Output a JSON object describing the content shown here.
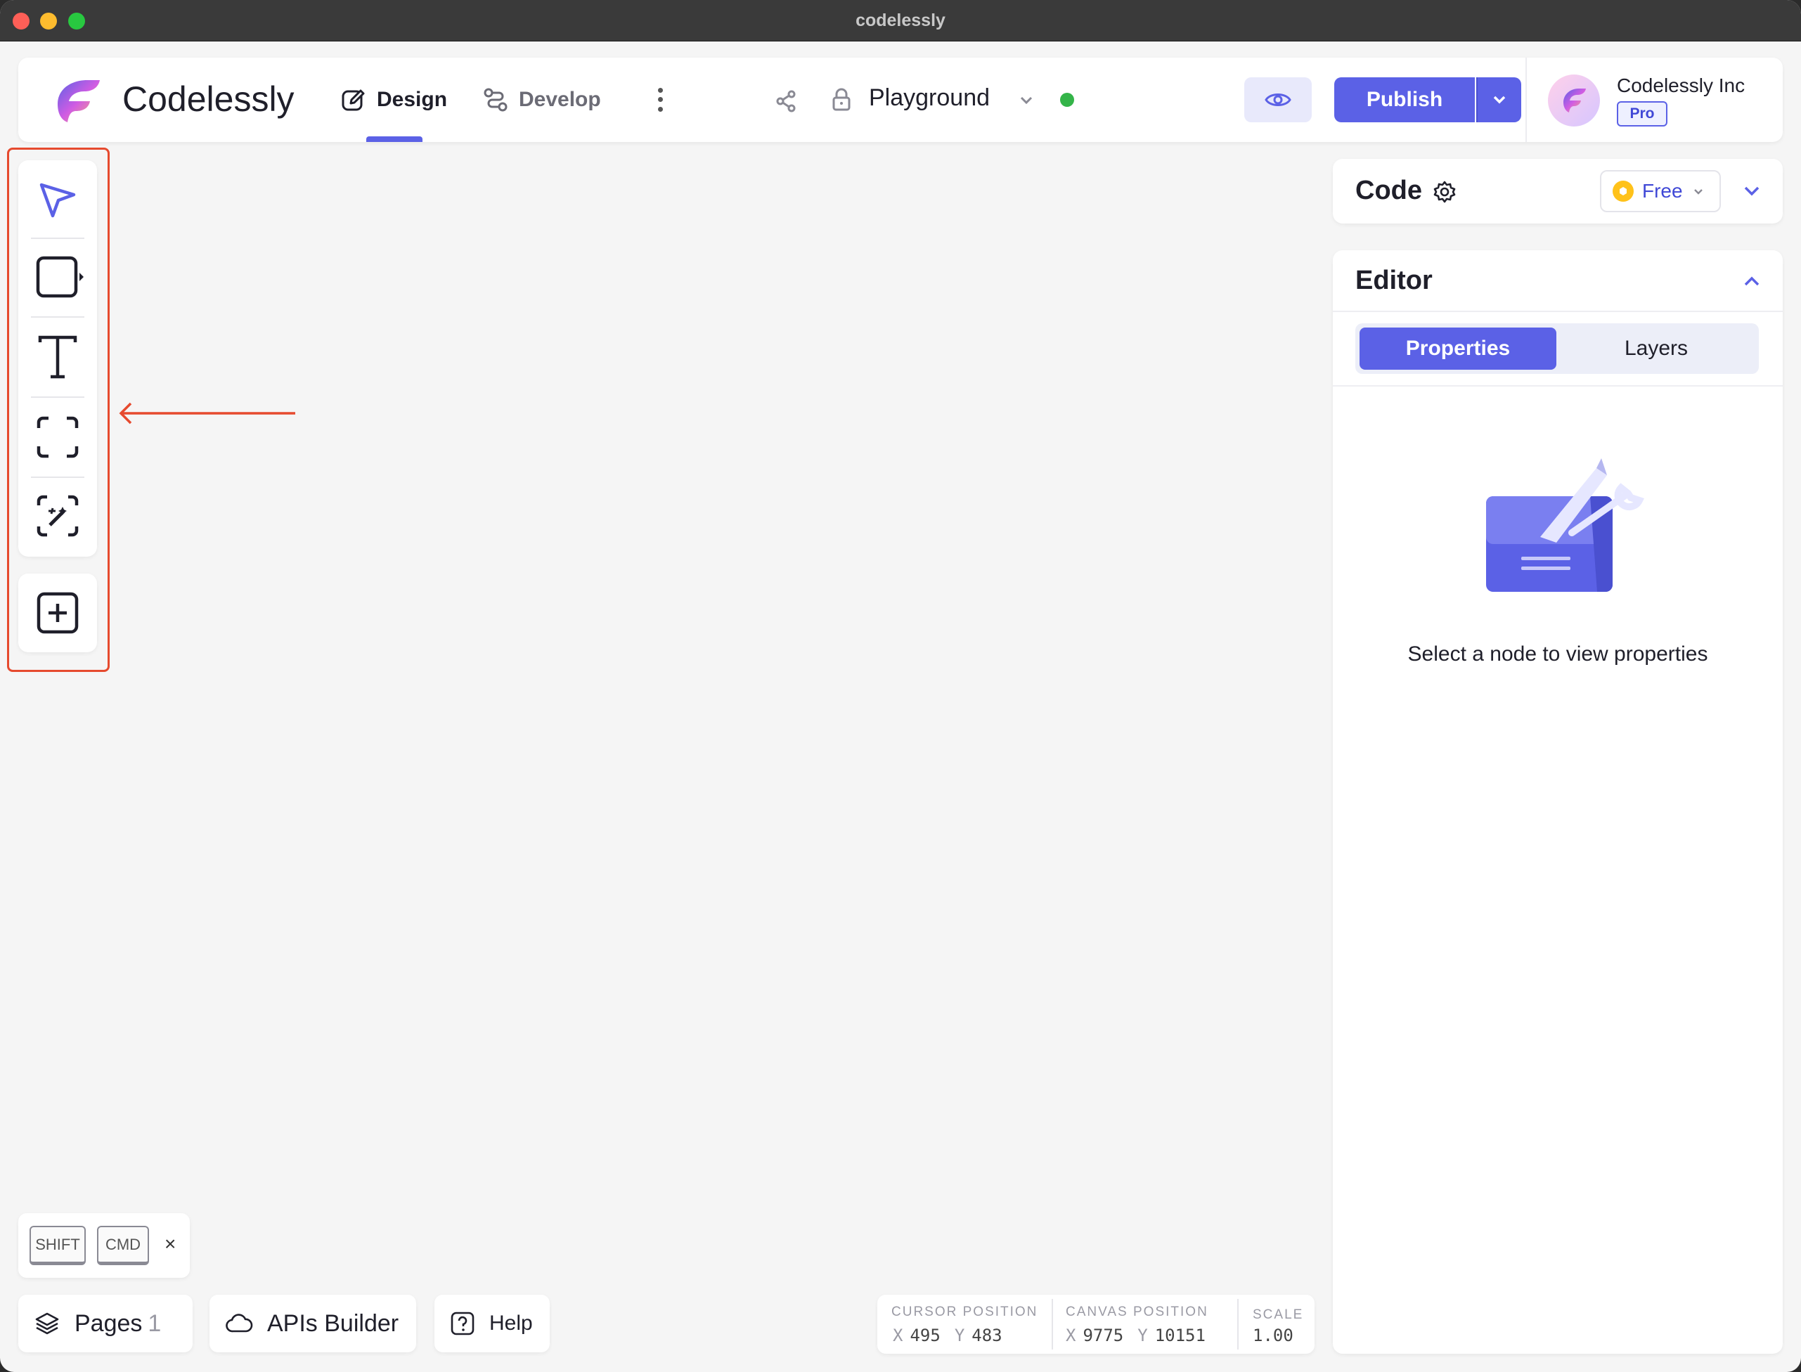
{
  "window": {
    "title": "codelessly"
  },
  "header": {
    "brand": "Codelessly",
    "tabs": [
      {
        "label": "Design",
        "active": true
      },
      {
        "label": "Develop",
        "active": false
      }
    ],
    "project_name": "Playground",
    "publish_label": "Publish",
    "org_name": "Codelessly Inc",
    "plan_badge": "Pro"
  },
  "code_panel": {
    "title": "Code",
    "plan_label": "Free"
  },
  "editor_panel": {
    "title": "Editor",
    "tabs": [
      {
        "label": "Properties",
        "active": true
      },
      {
        "label": "Layers",
        "active": false
      }
    ],
    "empty_message": "Select a node to view properties"
  },
  "toolbar": {
    "tools": [
      "pointer-tool",
      "shape-tool",
      "text-tool",
      "frame-tool",
      "magic-select-tool",
      "add-tool"
    ]
  },
  "keys": {
    "shift": "SHIFT",
    "cmd": "CMD",
    "close": "×"
  },
  "bottom": {
    "pages_label": "Pages",
    "pages_count": "1",
    "apis_label": "APIs Builder",
    "help_label": "Help"
  },
  "status": {
    "cursor_label": "CURSOR POSITION",
    "cursor_x": "495",
    "cursor_y": "483",
    "canvas_label": "CANVAS POSITION",
    "canvas_x": "9775",
    "canvas_y": "10151",
    "scale_label": "SCALE",
    "scale_value": "1.00",
    "x_axis": "X",
    "y_axis": "Y"
  },
  "colors": {
    "accent": "#5b61e6",
    "highlight": "#e64a2e",
    "status_online": "#34b449"
  }
}
